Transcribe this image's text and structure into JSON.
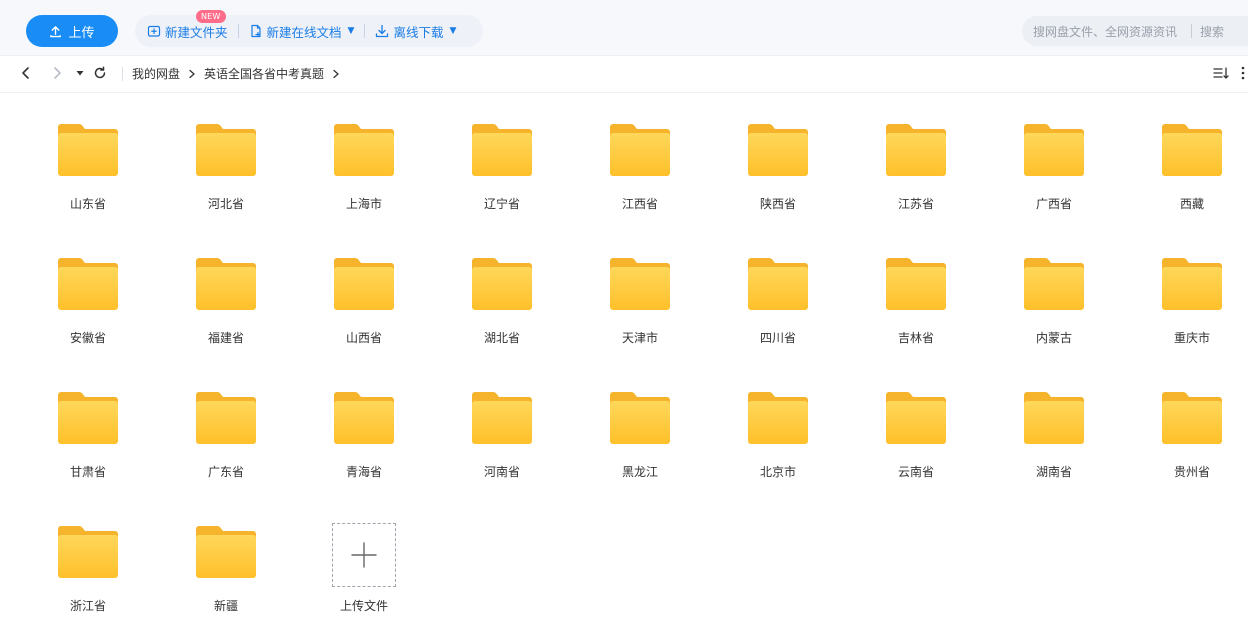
{
  "toolbar": {
    "upload_label": "上传",
    "new_folder_label": "新建文件夹",
    "new_online_doc_label": "新建在线文档",
    "new_badge": "NEW",
    "offline_download_label": "离线下载",
    "search_placeholder": "搜网盘文件、全网资源资讯",
    "search_right_label": "搜索"
  },
  "breadcrumb": {
    "items": [
      "我的网盘",
      "英语全国各省中考真题"
    ]
  },
  "folders": [
    "山东省",
    "河北省",
    "上海市",
    "辽宁省",
    "江西省",
    "陕西省",
    "江苏省",
    "广西省",
    "西藏",
    "安徽省",
    "福建省",
    "山西省",
    "湖北省",
    "天津市",
    "四川省",
    "吉林省",
    "内蒙古",
    "重庆市",
    "甘肃省",
    "广东省",
    "青海省",
    "河南省",
    "黑龙江",
    "北京市",
    "云南省",
    "湖南省",
    "贵州省",
    "浙江省",
    "新疆"
  ],
  "upload_tile": {
    "label": "上传文件"
  },
  "colors": {
    "accent": "#1a8cf5",
    "folder_front": "#ffc83d",
    "folder_back": "#f5b62b",
    "badge": "#ff6d8a"
  }
}
